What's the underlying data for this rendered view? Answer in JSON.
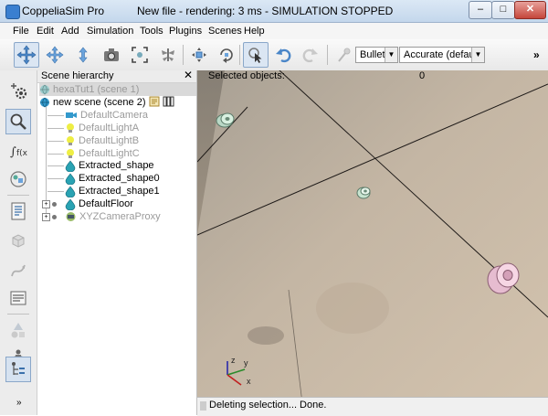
{
  "window": {
    "app_title": "CoppeliaSim Pro",
    "doc_title": "New file - rendering: 3 ms - SIMULATION STOPPED",
    "controls": {
      "minimize": "–",
      "maximize": "□",
      "close": "✕"
    }
  },
  "menu": [
    "File",
    "Edit",
    "Add",
    "Simulation",
    "Tools",
    "Plugins",
    "Scenes",
    "Help"
  ],
  "toolbar": {
    "icons": [
      "move-camera-icon",
      "pan-camera-icon",
      "zoom-camera-icon",
      "camera-icon",
      "fit-view-icon",
      "fly-icon",
      "object-shift-icon",
      "object-rotate-icon",
      "select-cursor-icon",
      "undo-icon",
      "redo-icon",
      "physics-engine-icon"
    ],
    "engine": "Bullet",
    "accuracy": "Accurate (default)",
    "more": "»"
  },
  "left_bar": {
    "icons": [
      "scene-properties-icon",
      "camera-zoom-icon",
      "calculation-modules-icon",
      "collections-icon",
      "scripts-icon",
      "shapes-icon",
      "paths-icon",
      "selection-icon",
      "model-browser-icon",
      "hierarchy-icon"
    ],
    "more": "»"
  },
  "hierarchy": {
    "title": "Scene hierarchy",
    "close": "✕",
    "rows": [
      {
        "label": "hexaTut1 (scene 1)",
        "style": "gray"
      },
      {
        "label": "new scene (scene 2)",
        "style": "normal"
      },
      {
        "label": "DefaultCamera",
        "style": "gray"
      },
      {
        "label": "DefaultLightA",
        "style": "gray"
      },
      {
        "label": "DefaultLightB",
        "style": "gray"
      },
      {
        "label": "DefaultLightC",
        "style": "gray"
      },
      {
        "label": "Extracted_shape",
        "style": "normal"
      },
      {
        "label": "Extracted_shape0",
        "style": "normal"
      },
      {
        "label": "Extracted_shape1",
        "style": "normal"
      },
      {
        "label": "DefaultFloor",
        "style": "normal"
      },
      {
        "label": "XYZCameraProxy",
        "style": "gray"
      }
    ]
  },
  "viewport": {
    "selected_label": "Selected objects:",
    "selected_count": "0",
    "axes": {
      "x": "x",
      "y": "y",
      "z": "z"
    }
  },
  "status": {
    "text": "Deleting selection... Done."
  }
}
